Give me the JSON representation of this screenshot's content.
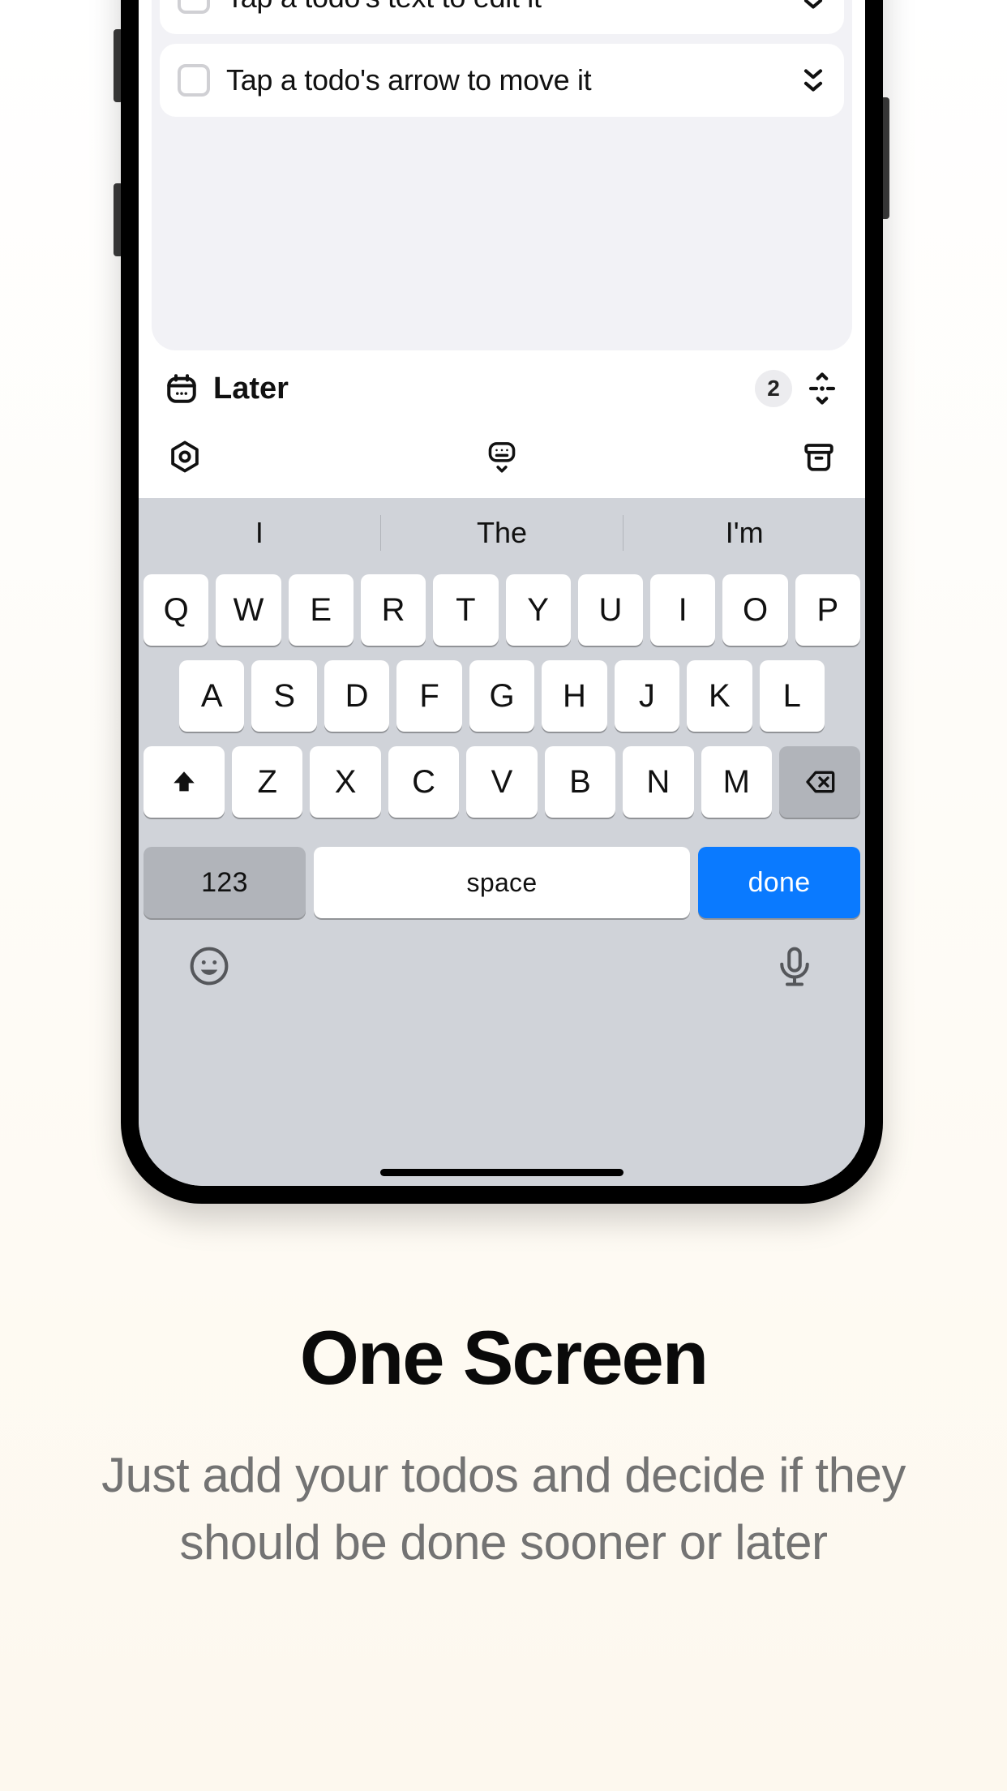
{
  "todos": [
    {
      "text": "Tap a todo's text to edit it"
    },
    {
      "text": "Tap a todo's arrow to move it"
    }
  ],
  "section": {
    "title": "Later",
    "count": "2"
  },
  "keyboard": {
    "suggestions": [
      "I",
      "The",
      "I'm"
    ],
    "row1": [
      "Q",
      "W",
      "E",
      "R",
      "T",
      "Y",
      "U",
      "I",
      "O",
      "P"
    ],
    "row2": [
      "A",
      "S",
      "D",
      "F",
      "G",
      "H",
      "J",
      "K",
      "L"
    ],
    "row3": [
      "Z",
      "X",
      "C",
      "V",
      "B",
      "N",
      "M"
    ],
    "numkey": "123",
    "space": "space",
    "done": "done"
  },
  "marketing": {
    "headline": "One Screen",
    "subhead": "Just add your todos and decide if they should be done sooner or later"
  }
}
